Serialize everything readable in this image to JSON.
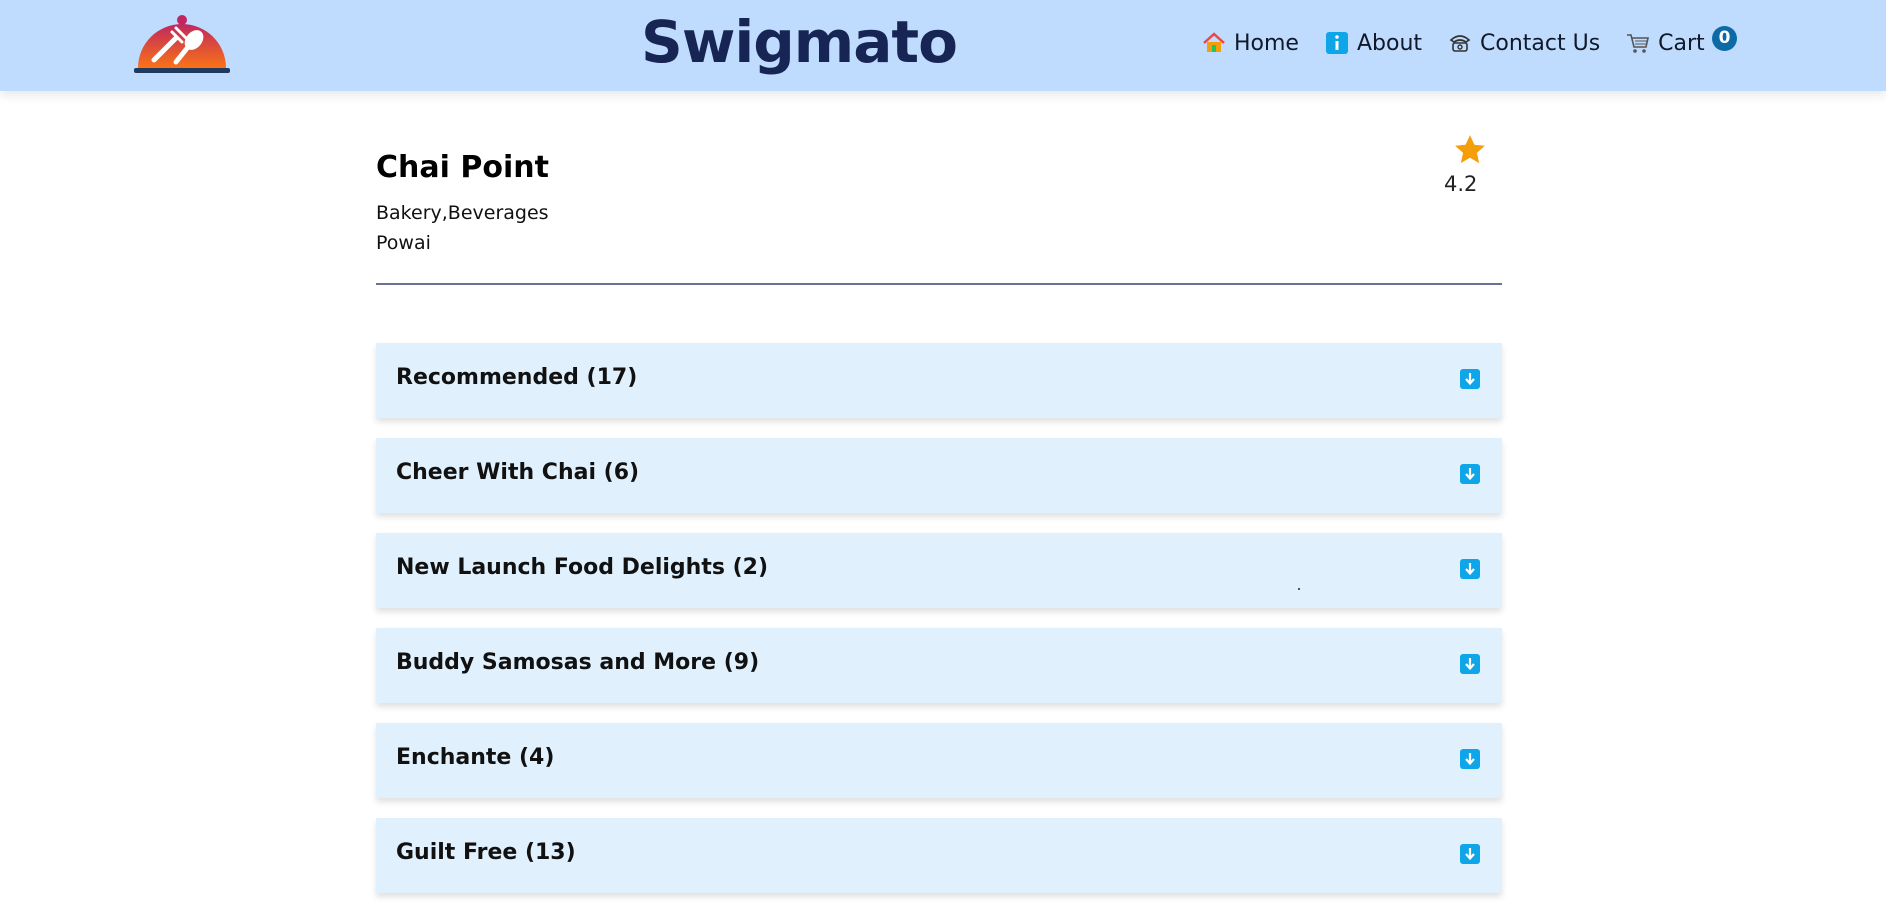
{
  "header": {
    "brand": "Swigmato",
    "nav": [
      {
        "label": "Home",
        "icon": "home-icon"
      },
      {
        "label": "About",
        "icon": "info-icon"
      },
      {
        "label": "Contact Us",
        "icon": "phone-icon"
      },
      {
        "label": "Cart",
        "icon": "cart-icon"
      }
    ],
    "cart_count": "0"
  },
  "restaurant": {
    "name": "Chai Point",
    "cuisines": "Bakery,Beverages",
    "area": "Powai",
    "rating": "4.2"
  },
  "categories": [
    {
      "title": "Recommended (17)"
    },
    {
      "title": "Cheer With Chai (6)"
    },
    {
      "title": "New Launch Food Delights (2)"
    },
    {
      "title": "Buddy Samosas and More (9)"
    },
    {
      "title": "Enchante (4)"
    },
    {
      "title": "Guilt Free (13)"
    }
  ],
  "colors": {
    "header_bg": "#bfdbfe",
    "brand": "#172554",
    "accordion_bg": "#e0f1fd",
    "toggle": "#0ea5e9",
    "star": "#f59e0b",
    "badge": "#0c6aa6"
  }
}
